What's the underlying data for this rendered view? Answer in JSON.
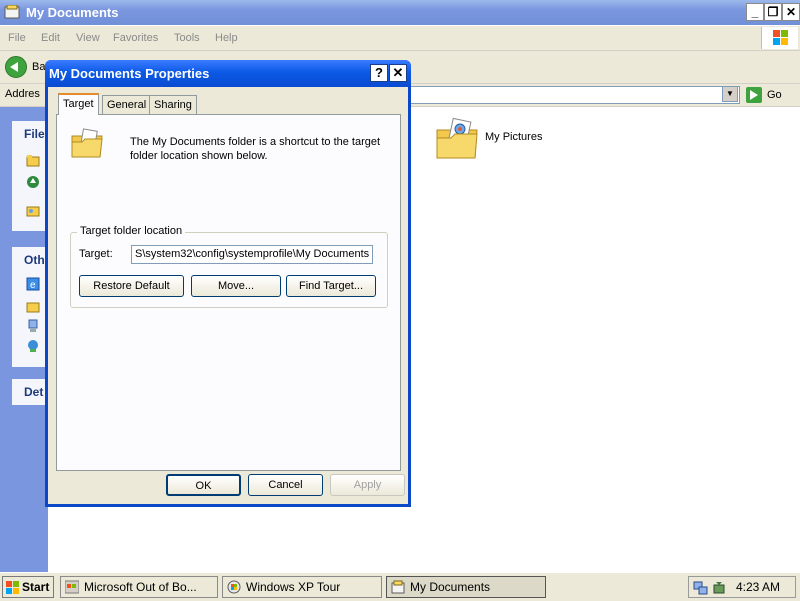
{
  "explorer": {
    "title": "My Documents",
    "menu": [
      "File",
      "Edit",
      "View",
      "Favorites",
      "Tools",
      "Help"
    ],
    "toolbar": {
      "back_label": "Ba"
    },
    "address": {
      "label": "Addres",
      "go_label": "Go"
    },
    "left_pane": {
      "file_tasks_header": "File",
      "other_places_header": "Oth",
      "details_header": "Det"
    },
    "items": [
      {
        "label": "My Pictures",
        "icon": "my-pictures-folder-icon"
      }
    ]
  },
  "dialog": {
    "title": "My Documents Properties",
    "tabs": [
      "Target",
      "General",
      "Sharing"
    ],
    "active_tab": "Target",
    "description": "The My Documents folder is a shortcut to the target folder location shown below.",
    "group_label": "Target folder location",
    "target_label": "Target:",
    "target_value": "S\\system32\\config\\systemprofile\\My Documents",
    "buttons": {
      "restore_default": "Restore Default",
      "move": "Move...",
      "find_target": "Find Target...",
      "ok": "OK",
      "cancel": "Cancel",
      "apply": "Apply"
    }
  },
  "taskbar": {
    "start_label": "Start",
    "tasks": [
      {
        "label": "Microsoft Out of Bo...",
        "icon": "oobe-icon",
        "active": false
      },
      {
        "label": "Windows XP Tour",
        "icon": "xp-tour-icon",
        "active": false
      },
      {
        "label": "My Documents",
        "icon": "my-documents-icon",
        "active": true
      }
    ],
    "clock": "4:23 AM"
  }
}
